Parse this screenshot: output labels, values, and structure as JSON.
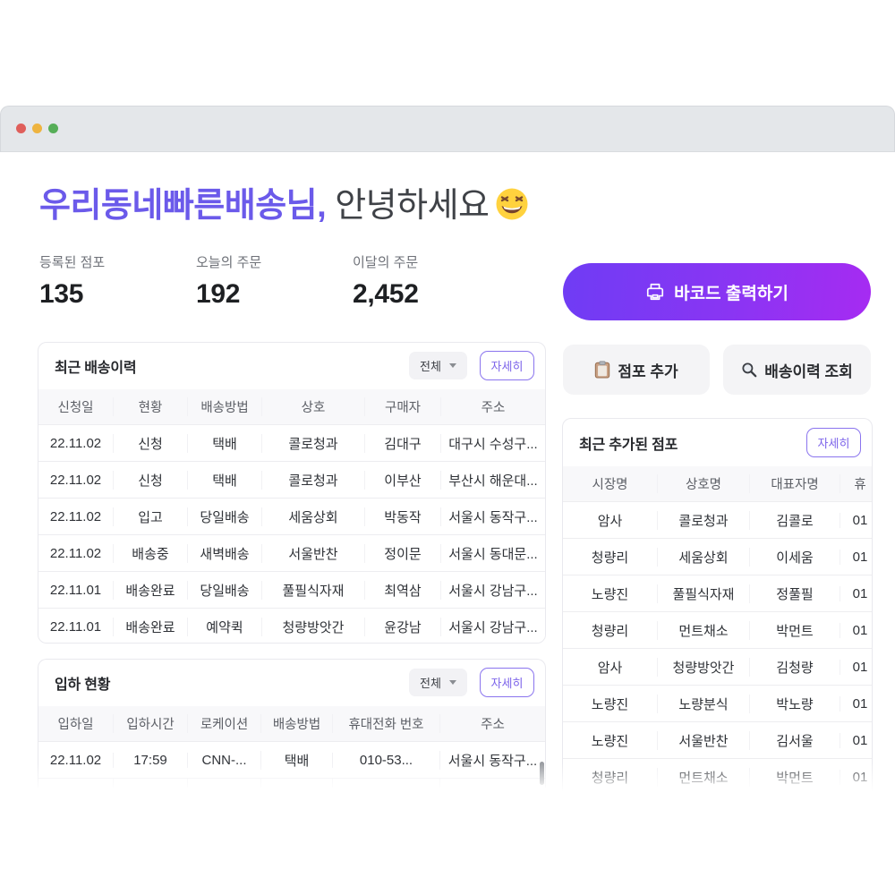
{
  "window": {
    "traffic_lights": {
      "red": "#df5f5b",
      "yellow": "#eeb440",
      "green": "#56ae58"
    }
  },
  "colors": {
    "accent_purple": "#6b5aea",
    "button_gradient_start": "#6f3cf4",
    "button_gradient_end": "#a62bf2",
    "detail_border": "#8a74ee"
  },
  "greeting": {
    "name": "우리동네빠른배송님,",
    "rest": "안녕하세요",
    "emoji": "laughing-squinting-face"
  },
  "stats": [
    {
      "label": "등록된 점포",
      "value": "135"
    },
    {
      "label": "오늘의 주문",
      "value": "192"
    },
    {
      "label": "이달의 주문",
      "value": "2,452"
    }
  ],
  "actions": {
    "print_barcode": {
      "label": "바코드 출력하기",
      "icon": "printer-icon"
    },
    "add_store": {
      "label": "점포 추가",
      "icon": "clipboard-icon"
    },
    "search_history": {
      "label": "배송이력 조회",
      "icon": "search-icon"
    }
  },
  "delivery_table": {
    "title": "최근 배송이력",
    "filter_value": "전체",
    "detail_label": "자세히",
    "columns": [
      "신청일",
      "현황",
      "배송방법",
      "상호",
      "구매자",
      "주소"
    ],
    "rows": [
      [
        "22.11.02",
        "신청",
        "택배",
        "콜로청과",
        "김대구",
        "대구시 수성구..."
      ],
      [
        "22.11.02",
        "신청",
        "택배",
        "콜로청과",
        "이부산",
        "부산시 해운대..."
      ],
      [
        "22.11.02",
        "입고",
        "당일배송",
        "세움상회",
        "박동작",
        "서울시 동작구..."
      ],
      [
        "22.11.02",
        "배송중",
        "새벽배송",
        "서울반찬",
        "정이문",
        "서울시 동대문..."
      ],
      [
        "22.11.01",
        "배송완료",
        "당일배송",
        "풀필식자재",
        "최역삼",
        "서울시 강남구..."
      ],
      [
        "22.11.01",
        "배송완료",
        "예약퀵",
        "청량방앗간",
        "윤강남",
        "서울시 강남구..."
      ]
    ]
  },
  "arrival_table": {
    "title": "입하 현황",
    "filter_value": "전체",
    "detail_label": "자세히",
    "columns": [
      "입하일",
      "입하시간",
      "로케이션",
      "배송방법",
      "휴대전화 번호",
      "주소"
    ],
    "rows": [
      [
        "22.11.02",
        "17:59",
        "CNN-...",
        "택배",
        "010-53...",
        "서울시 동작구..."
      ]
    ]
  },
  "stores_table": {
    "title": "최근 추가된 점포",
    "detail_label": "자세히",
    "columns": [
      "시장명",
      "상호명",
      "대표자명",
      "휴"
    ],
    "rows": [
      [
        "암사",
        "콜로청과",
        "김콜로",
        "01"
      ],
      [
        "청량리",
        "세움상회",
        "이세움",
        "01"
      ],
      [
        "노량진",
        "풀필식자재",
        "정풀필",
        "01"
      ],
      [
        "청량리",
        "먼트채소",
        "박먼트",
        "01"
      ],
      [
        "암사",
        "청량방앗간",
        "김청량",
        "01"
      ],
      [
        "노량진",
        "노량분식",
        "박노량",
        "01"
      ],
      [
        "노량진",
        "서울반찬",
        "김서울",
        "01"
      ],
      [
        "청량리",
        "먼트채소",
        "박먼트",
        "01"
      ]
    ]
  }
}
